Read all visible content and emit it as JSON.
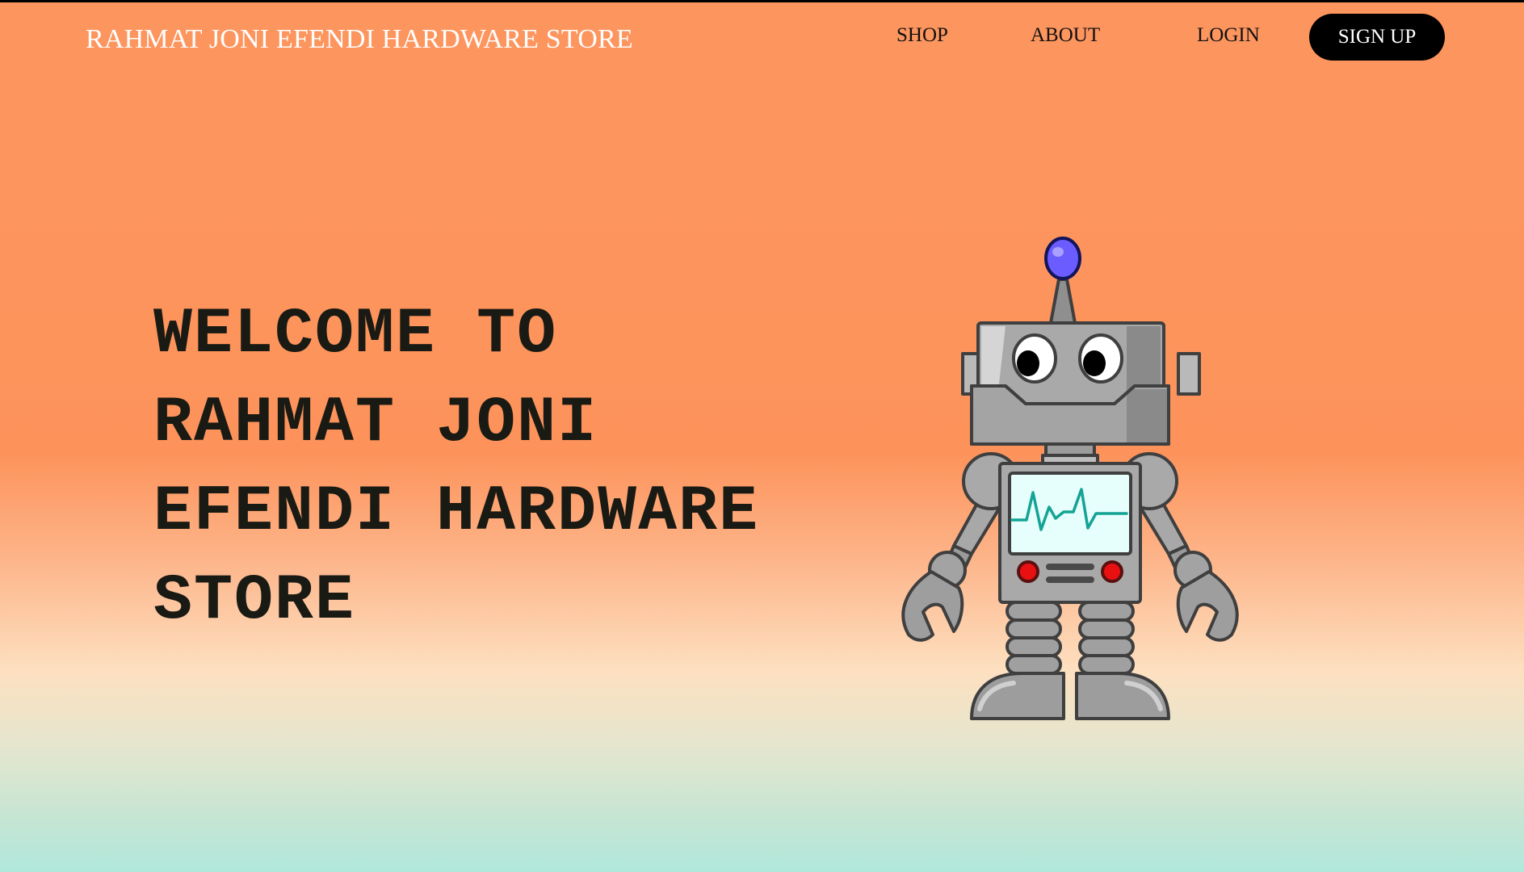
{
  "header": {
    "brand": "RAHMAT JONI EFENDI HARDWARE STORE",
    "nav": {
      "shop": "SHOP",
      "about": "ABOUT",
      "login": "LOGIN",
      "signup": "SIGN UP"
    }
  },
  "hero": {
    "title_lines": [
      "WELCOME TO",
      "RAHMAT JONI",
      "EFENDI HARDWARE",
      "STORE"
    ],
    "illustration_icon": "robot-illustration"
  },
  "colors": {
    "bg_top": "#fd955e",
    "bg_bottom": "#b0e8dc",
    "signup_bg": "#000000",
    "brand_text": "#ffffff",
    "title_text": "#1a1a14"
  }
}
